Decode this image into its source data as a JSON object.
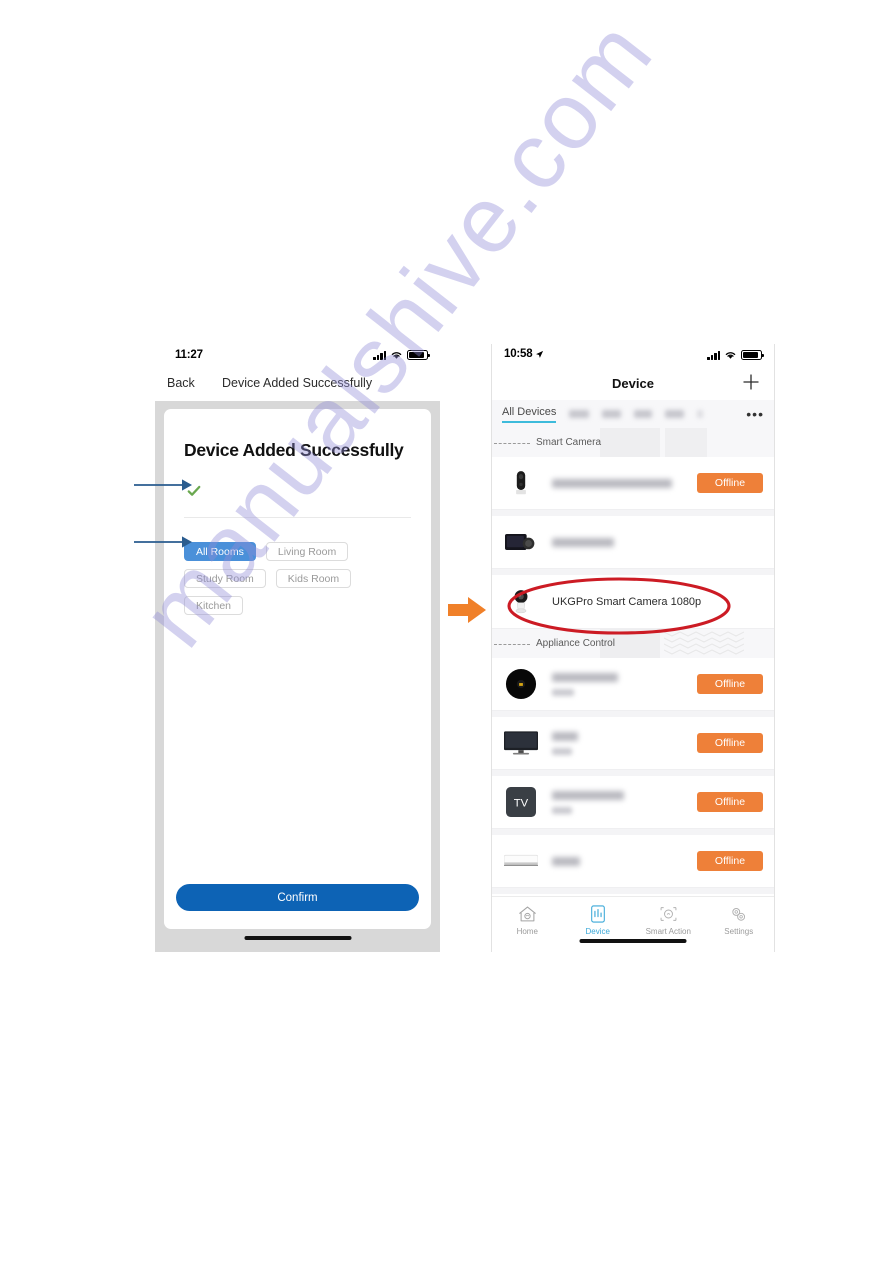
{
  "watermark": {
    "text": "manualshive.com"
  },
  "left_phone": {
    "status_bar": {
      "time": "11:27",
      "signal_icon": "cellular-signal-icon",
      "wifi_icon": "wifi-icon",
      "battery_icon": "battery-icon"
    },
    "nav": {
      "back_label": "Back",
      "title": "Device Added Successfully"
    },
    "card": {
      "title": "Device Added Successfully",
      "check_icon": "green-check-icon",
      "rooms": [
        {
          "label": "All Rooms",
          "selected": true
        },
        {
          "label": "Living Room",
          "selected": false
        },
        {
          "label": "Study Room",
          "selected": false
        },
        {
          "label": "Kids Room",
          "selected": false
        },
        {
          "label": "Kitchen",
          "selected": false
        }
      ],
      "confirm_label": "Confirm"
    }
  },
  "right_phone": {
    "status_bar": {
      "time": "10:58",
      "location_icon": "location-arrow-icon",
      "signal_icon": "cellular-signal-icon",
      "wifi_icon": "wifi-icon",
      "battery_icon": "battery-icon"
    },
    "nav": {
      "title": "Device",
      "add_icon": "plus-icon"
    },
    "tabs": {
      "active_label": "All Devices",
      "more_icon": "ellipsis-icon",
      "more_label": "•••"
    },
    "groups": [
      {
        "header": "Smart Camera",
        "devices": [
          {
            "icon": "doorbell-camera-icon",
            "name_visible": "",
            "name_redacted": true,
            "status": "Offline",
            "has_status": true
          },
          {
            "icon": "dashcam-icon",
            "name_visible": "",
            "name_redacted": true,
            "status": "",
            "has_status": false
          },
          {
            "icon": "pan-tilt-camera-icon",
            "name_visible": "UKGPro Smart Camera 1080p",
            "name_redacted": false,
            "status": "",
            "has_status": false
          }
        ]
      },
      {
        "header": "Appliance Control",
        "devices": [
          {
            "icon": "robot-vacuum-icon",
            "name_visible": "",
            "name_redacted": true,
            "status": "Offline",
            "has_status": true
          },
          {
            "icon": "television-icon",
            "name_visible": "",
            "name_redacted": true,
            "status": "Offline",
            "has_status": true
          },
          {
            "icon": "tv-box-icon",
            "name_visible": "",
            "name_redacted": true,
            "status": "Offline",
            "has_status": true,
            "box_label": "TV"
          },
          {
            "icon": "air-conditioner-icon",
            "name_visible": "",
            "name_redacted": true,
            "status": "Offline",
            "has_status": true
          }
        ]
      }
    ],
    "tabbar": [
      {
        "label": "Home",
        "icon": "home-icon",
        "active": false
      },
      {
        "label": "Device",
        "icon": "device-icon",
        "active": true
      },
      {
        "label": "Smart Action",
        "icon": "smart-action-icon",
        "active": false
      },
      {
        "label": "Settings",
        "icon": "settings-gears-icon",
        "active": false
      }
    ]
  },
  "annotations": {
    "arrow_check": "blue-arrow-to-checkmark",
    "arrow_all_rooms": "blue-arrow-to-all-rooms",
    "arrow_camera": "orange-arrow-to-camera",
    "ellipse_camera": "red-ellipse-highlight"
  },
  "colors": {
    "accent_blue": "#4a90d9",
    "confirm_blue": "#0d63b5",
    "offline_orange": "#ee8039",
    "tab_active": "#3aa8d8",
    "annotation_red": "#cc1b24",
    "annotation_orange": "#f08029",
    "annotation_blue": "#2a5c8f",
    "watermark": "#928cd6"
  }
}
